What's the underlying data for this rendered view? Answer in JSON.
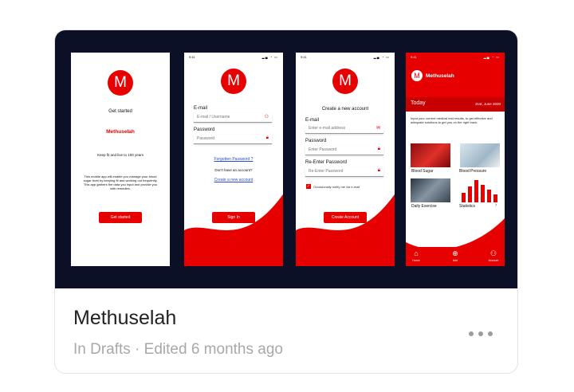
{
  "card": {
    "title": "Methuselah",
    "subtitle": "In Drafts · Edited 6 months ago"
  },
  "screens": {
    "start": {
      "logo": "M",
      "heading": "Get started",
      "brand": "Methuselah",
      "tagline": "Keep fit and live to 100 years",
      "description": "This mobile app will enable you manage your blood sugar level by keeping fit and working out frequently. This app gathers the data you input and provide you with remedies.",
      "button": "Get started"
    },
    "signin": {
      "time": "9:41",
      "logo": "M",
      "email_label": "E-mail",
      "email_placeholder": "E-mail / Username",
      "password_label": "Password",
      "password_placeholder": "Password",
      "forgot_link": "Forgotten Password ?",
      "no_account": "Don't have an account?",
      "create_link": "Create a new account",
      "button": "Sign In"
    },
    "create": {
      "time": "9:41",
      "logo": "M",
      "heading": "Create a new account",
      "email_label": "E-mail",
      "email_placeholder": "Enter e-mail address",
      "password_label": "Password",
      "password_placeholder": "Enter Password",
      "reenter_label": "Re-Enter Password",
      "reenter_placeholder": "Re-Enter Password",
      "checkbox_label": "Occasionally notify me via e-mail",
      "button": "Create Account"
    },
    "dashboard": {
      "time": "9:41",
      "logo": "M",
      "brand": "Methuselah",
      "today": "Today",
      "date": "31st, June 2020",
      "intro": "Input your current medical test results, to get effective and adequate solutions to get you on the right track.",
      "tiles": [
        "Blood Sugar",
        "Blood Pressure",
        "Daily Exercise",
        "Statistics"
      ],
      "tabs": [
        "Home",
        "Add",
        "Account"
      ]
    }
  },
  "colors": {
    "accent": "#e60000",
    "thumb_bg": "#0c1026"
  }
}
